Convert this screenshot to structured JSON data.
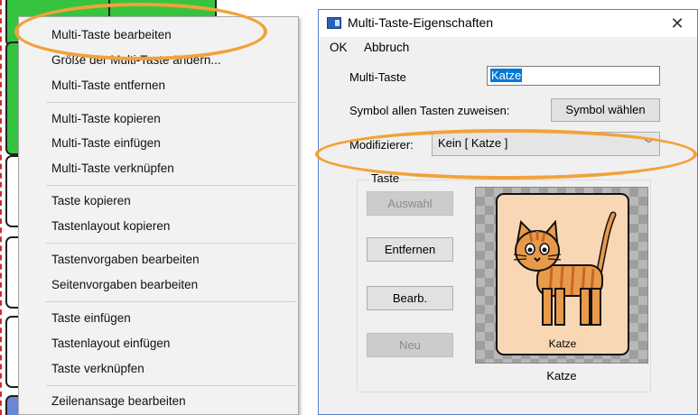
{
  "context_menu": {
    "items": [
      {
        "label": "Multi-Taste bearbeiten"
      },
      {
        "label": "Größe der Multi-Taste ändern..."
      },
      {
        "label": "Multi-Taste entfernen"
      },
      {
        "label": "Multi-Taste kopieren"
      },
      {
        "label": "Multi-Taste einfügen"
      },
      {
        "label": "Multi-Taste verknüpfen"
      },
      {
        "label": "Taste kopieren"
      },
      {
        "label": "Tastenlayout kopieren"
      },
      {
        "label": "Tastenvorgaben bearbeiten"
      },
      {
        "label": "Seitenvorgaben bearbeiten"
      },
      {
        "label": "Taste einfügen"
      },
      {
        "label": "Tastenlayout einfügen"
      },
      {
        "label": "Taste verknüpfen"
      },
      {
        "label": "Zeilenansage bearbeiten"
      }
    ]
  },
  "dialog": {
    "title": "Multi-Taste-Eigenschaften",
    "close_glyph": "✕",
    "menu": {
      "ok": "OK",
      "cancel": "Abbruch"
    },
    "name_label": "Multi-Taste",
    "name_value": "Katze",
    "symbol_all_label": "Symbol allen Tasten zuweisen:",
    "symbol_choose_button": "Symbol wählen",
    "modifier_label": "Modifizierer:",
    "modifier_value": "Kein [ Katze ]",
    "modifier_chevron": "﹀",
    "group_label": "Taste",
    "buttons": {
      "select": "Auswahl",
      "remove": "Entfernen",
      "edit": "Bearb.",
      "new": "Neu"
    },
    "symbol_card_label": "Katze",
    "symbol_caption": "Katze"
  },
  "colors": {
    "highlight": "#f2a23a",
    "tile_green": "#36c43f",
    "tile_blue": "#6a86d6",
    "selection": "#0078d7",
    "cat_orange": "#e89a4a",
    "cat_stripe": "#c8662a"
  }
}
